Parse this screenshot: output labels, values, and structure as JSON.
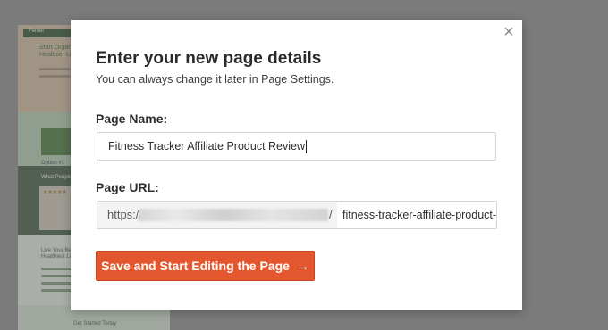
{
  "background_preview": {
    "nav_label": "Fenter",
    "hero_heading": "Start Organic Fitness & Get a Healthier Life",
    "section_caption": "Option #1",
    "testimonials_title": "What People Are Saying",
    "stars": "★★★★★",
    "feature_title": "Live Your Best and Healthiest Life",
    "footer_title": "Get Started Today"
  },
  "modal": {
    "close_icon": "close-icon",
    "close_glyph": "×",
    "title": "Enter your new page details",
    "subtitle": "You can always change it later in Page Settings.",
    "page_name_label": "Page Name:",
    "page_name_value": "Fitness Tracker Affiliate Product Review",
    "page_url_label": "Page URL:",
    "url_prefix": "https://",
    "url_slash": "/",
    "url_slug": "fitness-tracker-affiliate-product-r",
    "submit_label": "Save and Start Editing the Page",
    "submit_arrow": "→"
  },
  "colors": {
    "overlay": "#7b7b7b",
    "accent": "#e4572e",
    "modal_bg": "#ffffff"
  }
}
